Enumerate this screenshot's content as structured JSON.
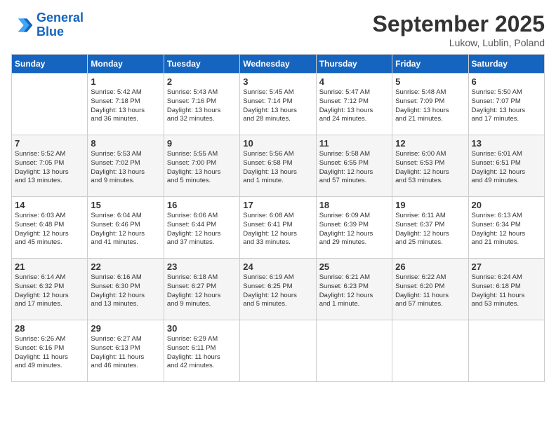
{
  "header": {
    "logo_line1": "General",
    "logo_line2": "Blue",
    "month": "September 2025",
    "location": "Lukow, Lublin, Poland"
  },
  "days_of_week": [
    "Sunday",
    "Monday",
    "Tuesday",
    "Wednesday",
    "Thursday",
    "Friday",
    "Saturday"
  ],
  "weeks": [
    [
      {
        "day": "",
        "info": ""
      },
      {
        "day": "1",
        "info": "Sunrise: 5:42 AM\nSunset: 7:18 PM\nDaylight: 13 hours\nand 36 minutes."
      },
      {
        "day": "2",
        "info": "Sunrise: 5:43 AM\nSunset: 7:16 PM\nDaylight: 13 hours\nand 32 minutes."
      },
      {
        "day": "3",
        "info": "Sunrise: 5:45 AM\nSunset: 7:14 PM\nDaylight: 13 hours\nand 28 minutes."
      },
      {
        "day": "4",
        "info": "Sunrise: 5:47 AM\nSunset: 7:12 PM\nDaylight: 13 hours\nand 24 minutes."
      },
      {
        "day": "5",
        "info": "Sunrise: 5:48 AM\nSunset: 7:09 PM\nDaylight: 13 hours\nand 21 minutes."
      },
      {
        "day": "6",
        "info": "Sunrise: 5:50 AM\nSunset: 7:07 PM\nDaylight: 13 hours\nand 17 minutes."
      }
    ],
    [
      {
        "day": "7",
        "info": "Sunrise: 5:52 AM\nSunset: 7:05 PM\nDaylight: 13 hours\nand 13 minutes."
      },
      {
        "day": "8",
        "info": "Sunrise: 5:53 AM\nSunset: 7:02 PM\nDaylight: 13 hours\nand 9 minutes."
      },
      {
        "day": "9",
        "info": "Sunrise: 5:55 AM\nSunset: 7:00 PM\nDaylight: 13 hours\nand 5 minutes."
      },
      {
        "day": "10",
        "info": "Sunrise: 5:56 AM\nSunset: 6:58 PM\nDaylight: 13 hours\nand 1 minute."
      },
      {
        "day": "11",
        "info": "Sunrise: 5:58 AM\nSunset: 6:55 PM\nDaylight: 12 hours\nand 57 minutes."
      },
      {
        "day": "12",
        "info": "Sunrise: 6:00 AM\nSunset: 6:53 PM\nDaylight: 12 hours\nand 53 minutes."
      },
      {
        "day": "13",
        "info": "Sunrise: 6:01 AM\nSunset: 6:51 PM\nDaylight: 12 hours\nand 49 minutes."
      }
    ],
    [
      {
        "day": "14",
        "info": "Sunrise: 6:03 AM\nSunset: 6:48 PM\nDaylight: 12 hours\nand 45 minutes."
      },
      {
        "day": "15",
        "info": "Sunrise: 6:04 AM\nSunset: 6:46 PM\nDaylight: 12 hours\nand 41 minutes."
      },
      {
        "day": "16",
        "info": "Sunrise: 6:06 AM\nSunset: 6:44 PM\nDaylight: 12 hours\nand 37 minutes."
      },
      {
        "day": "17",
        "info": "Sunrise: 6:08 AM\nSunset: 6:41 PM\nDaylight: 12 hours\nand 33 minutes."
      },
      {
        "day": "18",
        "info": "Sunrise: 6:09 AM\nSunset: 6:39 PM\nDaylight: 12 hours\nand 29 minutes."
      },
      {
        "day": "19",
        "info": "Sunrise: 6:11 AM\nSunset: 6:37 PM\nDaylight: 12 hours\nand 25 minutes."
      },
      {
        "day": "20",
        "info": "Sunrise: 6:13 AM\nSunset: 6:34 PM\nDaylight: 12 hours\nand 21 minutes."
      }
    ],
    [
      {
        "day": "21",
        "info": "Sunrise: 6:14 AM\nSunset: 6:32 PM\nDaylight: 12 hours\nand 17 minutes."
      },
      {
        "day": "22",
        "info": "Sunrise: 6:16 AM\nSunset: 6:30 PM\nDaylight: 12 hours\nand 13 minutes."
      },
      {
        "day": "23",
        "info": "Sunrise: 6:18 AM\nSunset: 6:27 PM\nDaylight: 12 hours\nand 9 minutes."
      },
      {
        "day": "24",
        "info": "Sunrise: 6:19 AM\nSunset: 6:25 PM\nDaylight: 12 hours\nand 5 minutes."
      },
      {
        "day": "25",
        "info": "Sunrise: 6:21 AM\nSunset: 6:23 PM\nDaylight: 12 hours\nand 1 minute."
      },
      {
        "day": "26",
        "info": "Sunrise: 6:22 AM\nSunset: 6:20 PM\nDaylight: 11 hours\nand 57 minutes."
      },
      {
        "day": "27",
        "info": "Sunrise: 6:24 AM\nSunset: 6:18 PM\nDaylight: 11 hours\nand 53 minutes."
      }
    ],
    [
      {
        "day": "28",
        "info": "Sunrise: 6:26 AM\nSunset: 6:16 PM\nDaylight: 11 hours\nand 49 minutes."
      },
      {
        "day": "29",
        "info": "Sunrise: 6:27 AM\nSunset: 6:13 PM\nDaylight: 11 hours\nand 46 minutes."
      },
      {
        "day": "30",
        "info": "Sunrise: 6:29 AM\nSunset: 6:11 PM\nDaylight: 11 hours\nand 42 minutes."
      },
      {
        "day": "",
        "info": ""
      },
      {
        "day": "",
        "info": ""
      },
      {
        "day": "",
        "info": ""
      },
      {
        "day": "",
        "info": ""
      }
    ]
  ]
}
